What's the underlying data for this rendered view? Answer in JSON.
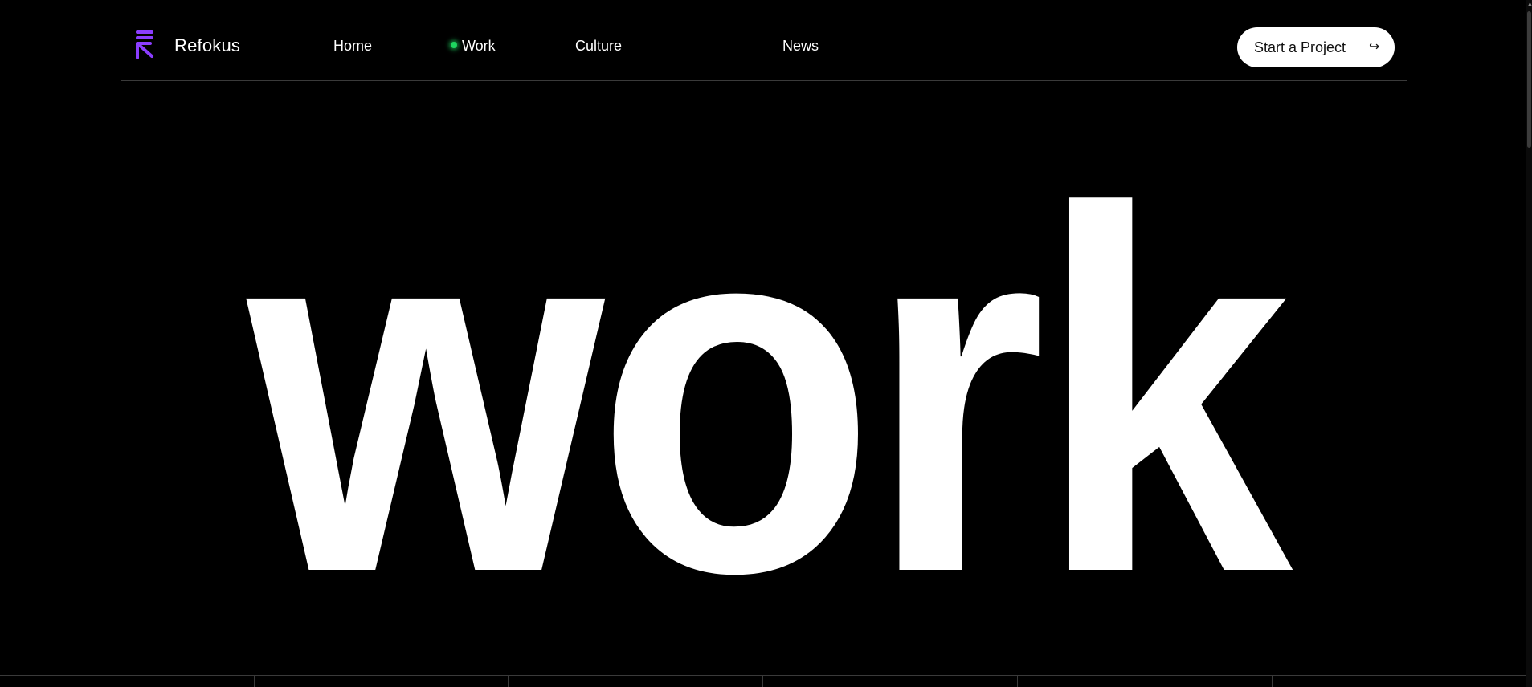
{
  "header": {
    "brand": "Refokus",
    "nav": {
      "home": "Home",
      "work": "Work",
      "culture": "Culture",
      "news": "News"
    },
    "cta": {
      "label": "Start a Project",
      "arrow": "↪"
    }
  },
  "hero": {
    "title": "work"
  },
  "colors": {
    "background": "#000000",
    "accent_logo": "#7c3aed",
    "active_dot": "#1ed65f",
    "cta_background": "#ffffff"
  },
  "icons": {
    "logo": "refokus-arrow-logo-icon",
    "cta": "return-arrow-icon",
    "active": "status-dot-icon"
  }
}
